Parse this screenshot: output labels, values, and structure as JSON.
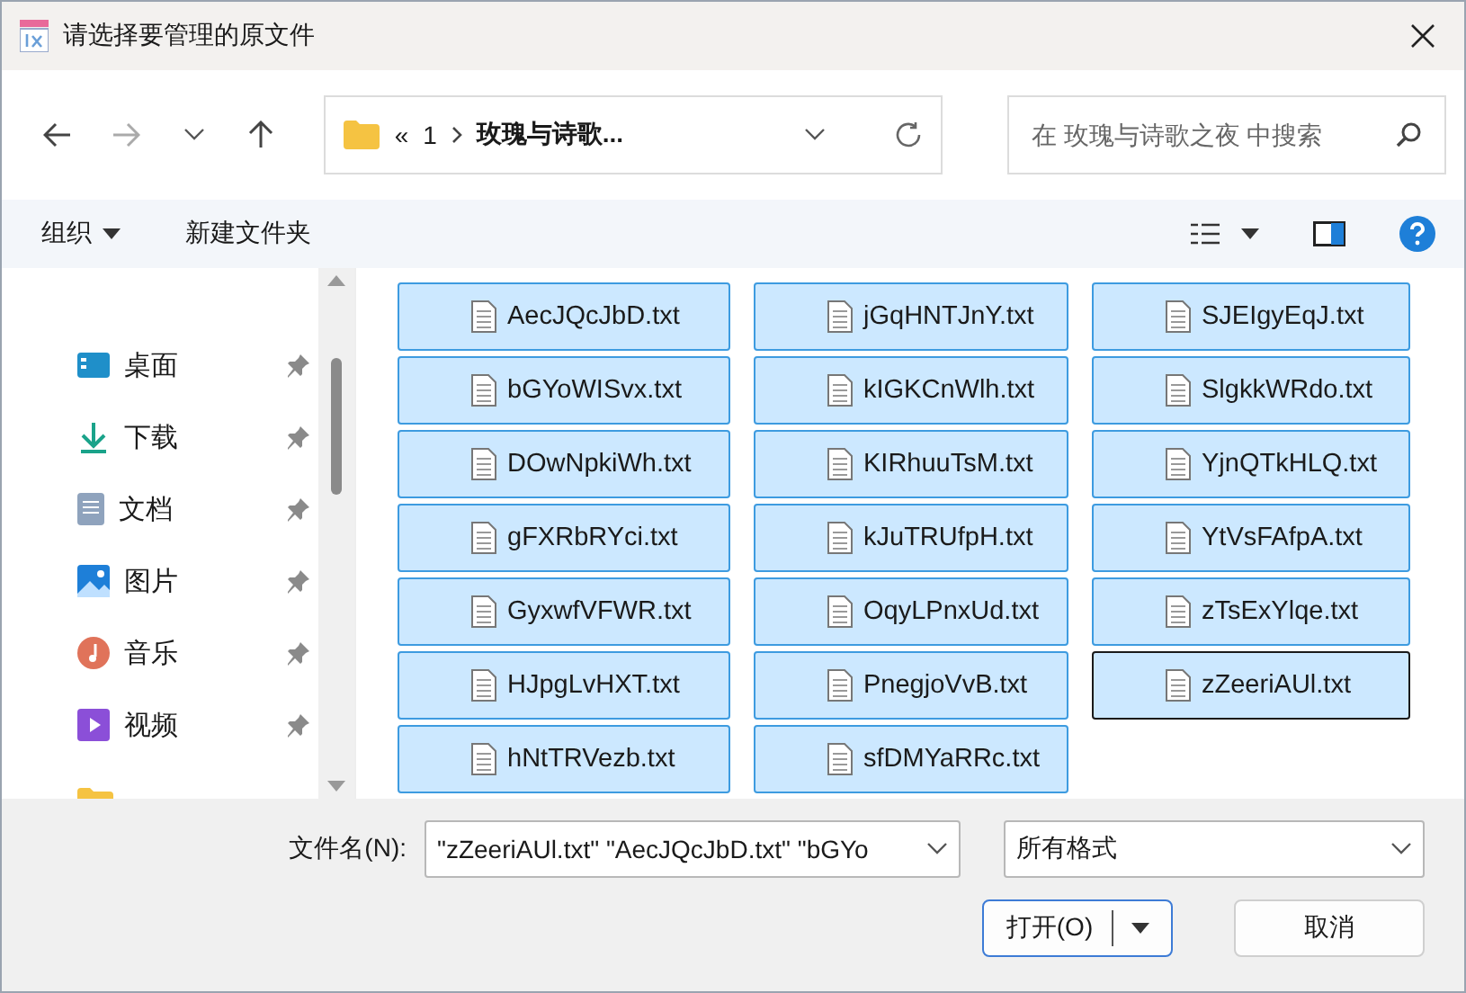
{
  "window": {
    "title": "请选择要管理的原文件"
  },
  "address": {
    "overflow": "«",
    "path": [
      "1",
      "玫瑰与诗歌..."
    ]
  },
  "search": {
    "placeholder": "在 玫瑰与诗歌之夜 中搜索"
  },
  "toolbar": {
    "organize": "组织",
    "new_folder": "新建文件夹"
  },
  "sidebar": {
    "items": [
      {
        "label": "桌面",
        "kind": "desktop",
        "pinned": true
      },
      {
        "label": "下载",
        "kind": "download",
        "pinned": true
      },
      {
        "label": "文档",
        "kind": "documents",
        "pinned": true
      },
      {
        "label": "图片",
        "kind": "pictures",
        "pinned": true
      },
      {
        "label": "音乐",
        "kind": "music",
        "pinned": true
      },
      {
        "label": "视频",
        "kind": "videos",
        "pinned": true
      }
    ]
  },
  "files": [
    {
      "name": "AecJQcJbD.txt",
      "selected": true,
      "focused": false
    },
    {
      "name": "bGYoWISvx.txt",
      "selected": true,
      "focused": false
    },
    {
      "name": "DOwNpkiWh.txt",
      "selected": true,
      "focused": false
    },
    {
      "name": "gFXRbRYci.txt",
      "selected": true,
      "focused": false
    },
    {
      "name": "GyxwfVFWR.txt",
      "selected": true,
      "focused": false
    },
    {
      "name": "HJpgLvHXT.txt",
      "selected": true,
      "focused": false
    },
    {
      "name": "hNtTRVezb.txt",
      "selected": true,
      "focused": false
    },
    {
      "name": "jGqHNTJnY.txt",
      "selected": true,
      "focused": false
    },
    {
      "name": "kIGKCnWlh.txt",
      "selected": true,
      "focused": false
    },
    {
      "name": "KIRhuuTsM.txt",
      "selected": true,
      "focused": false
    },
    {
      "name": "kJuTRUfpH.txt",
      "selected": true,
      "focused": false
    },
    {
      "name": "OqyLPnxUd.txt",
      "selected": true,
      "focused": false
    },
    {
      "name": "PnegjoVvB.txt",
      "selected": true,
      "focused": false
    },
    {
      "name": "sfDMYaRRc.txt",
      "selected": true,
      "focused": false
    },
    {
      "name": "SJEIgyEqJ.txt",
      "selected": true,
      "focused": false
    },
    {
      "name": "SlgkkWRdo.txt",
      "selected": true,
      "focused": false
    },
    {
      "name": "YjnQTkHLQ.txt",
      "selected": true,
      "focused": false
    },
    {
      "name": "YtVsFAfpA.txt",
      "selected": true,
      "focused": false
    },
    {
      "name": "zTsExYlqe.txt",
      "selected": true,
      "focused": false
    },
    {
      "name": "zZeeriAUl.txt",
      "selected": true,
      "focused": true
    }
  ],
  "filename": {
    "label": "文件名(N):",
    "value": "\"zZeeriAUl.txt\" \"AecJQcJbD.txt\" \"bGYo"
  },
  "filetype": {
    "value": "所有格式"
  },
  "buttons": {
    "open": "打开(O)",
    "cancel": "取消"
  }
}
